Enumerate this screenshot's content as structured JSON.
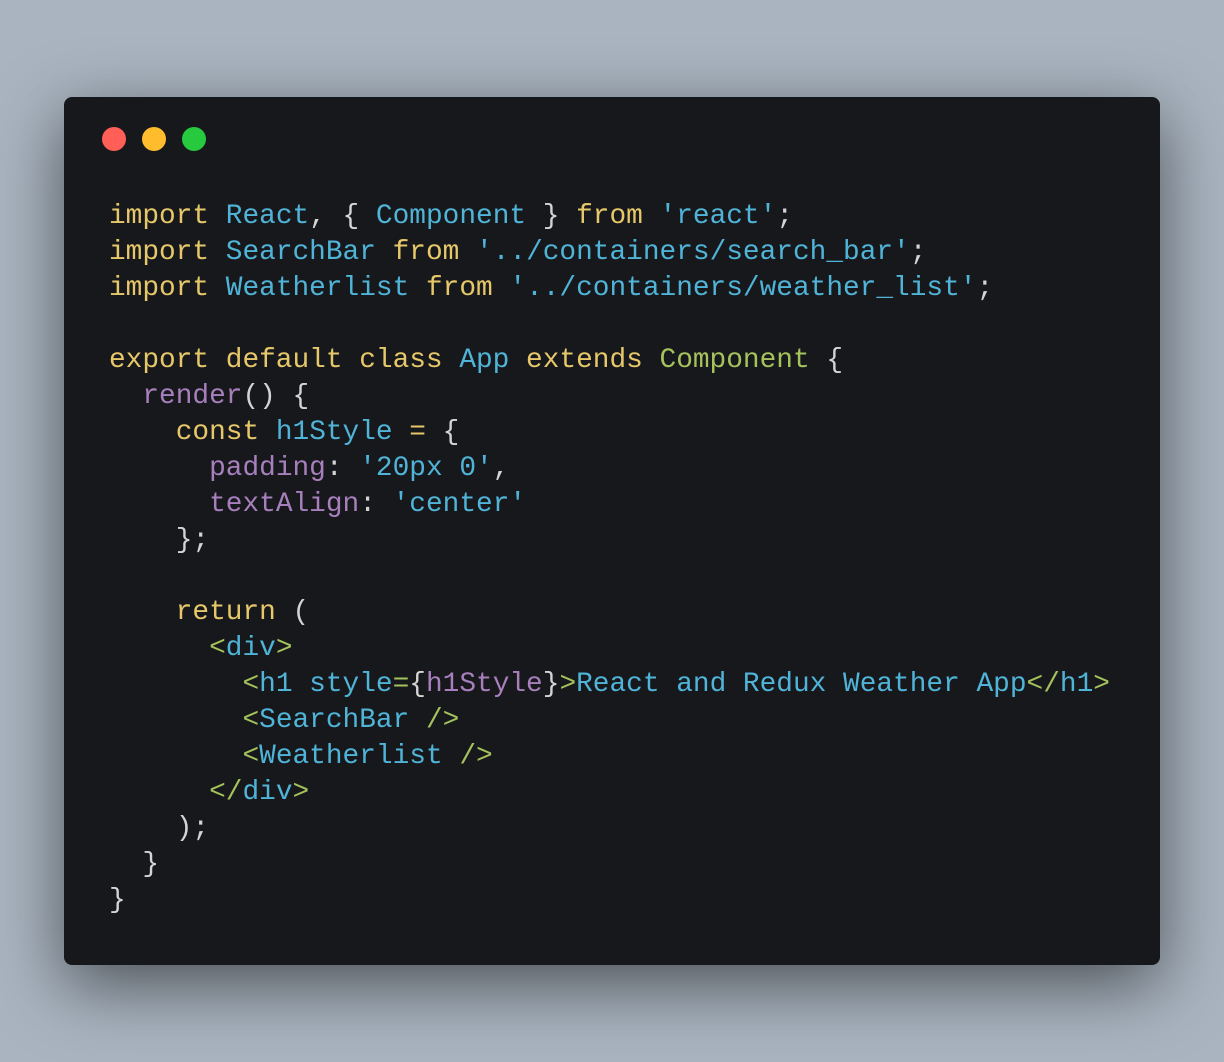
{
  "window": {
    "controls": [
      "close",
      "minimize",
      "maximize"
    ],
    "colors": {
      "close": "#ff5f56",
      "minimize": "#ffbd2e",
      "maximize": "#27c93f",
      "background": "#17181b",
      "page": "#a9b4c0"
    }
  },
  "code": {
    "lines": [
      [
        [
          "kw",
          "import"
        ],
        [
          "pun",
          " "
        ],
        [
          "id",
          "React"
        ],
        [
          "pun",
          ", { "
        ],
        [
          "id",
          "Component"
        ],
        [
          "pun",
          " } "
        ],
        [
          "kw",
          "from"
        ],
        [
          "pun",
          " "
        ],
        [
          "str",
          "'react'"
        ],
        [
          "pun",
          ";"
        ]
      ],
      [
        [
          "kw",
          "import"
        ],
        [
          "pun",
          " "
        ],
        [
          "id",
          "SearchBar"
        ],
        [
          "pun",
          " "
        ],
        [
          "kw",
          "from"
        ],
        [
          "pun",
          " "
        ],
        [
          "str",
          "'../containers/search_bar'"
        ],
        [
          "pun",
          ";"
        ]
      ],
      [
        [
          "kw",
          "import"
        ],
        [
          "pun",
          " "
        ],
        [
          "id",
          "Weatherlist"
        ],
        [
          "pun",
          " "
        ],
        [
          "kw",
          "from"
        ],
        [
          "pun",
          " "
        ],
        [
          "str",
          "'../containers/weather_list'"
        ],
        [
          "pun",
          ";"
        ]
      ],
      [],
      [
        [
          "kw",
          "export default class"
        ],
        [
          "pun",
          " "
        ],
        [
          "id",
          "App"
        ],
        [
          "pun",
          " "
        ],
        [
          "kw",
          "extends"
        ],
        [
          "pun",
          " "
        ],
        [
          "cls",
          "Component"
        ],
        [
          "pun",
          " {"
        ]
      ],
      [
        [
          "pun",
          "  "
        ],
        [
          "fn",
          "render"
        ],
        [
          "pun",
          "() {"
        ]
      ],
      [
        [
          "pun",
          "    "
        ],
        [
          "kw",
          "const"
        ],
        [
          "pun",
          " "
        ],
        [
          "id",
          "h1Style"
        ],
        [
          "pun",
          " "
        ],
        [
          "kw",
          "="
        ],
        [
          "pun",
          " {"
        ]
      ],
      [
        [
          "pun",
          "      "
        ],
        [
          "prop",
          "padding"
        ],
        [
          "pun",
          ": "
        ],
        [
          "str",
          "'20px 0'"
        ],
        [
          "pun",
          ","
        ]
      ],
      [
        [
          "pun",
          "      "
        ],
        [
          "prop",
          "textAlign"
        ],
        [
          "pun",
          ": "
        ],
        [
          "str",
          "'center'"
        ]
      ],
      [
        [
          "pun",
          "    };"
        ]
      ],
      [],
      [
        [
          "pun",
          "    "
        ],
        [
          "kw",
          "return"
        ],
        [
          "pun",
          " ("
        ]
      ],
      [
        [
          "pun",
          "      "
        ],
        [
          "tag",
          "<"
        ],
        [
          "tn",
          "div"
        ],
        [
          "tag",
          ">"
        ]
      ],
      [
        [
          "pun",
          "        "
        ],
        [
          "tag",
          "<"
        ],
        [
          "tn",
          "h1 style"
        ],
        [
          "tag",
          "="
        ],
        [
          "pun",
          "{"
        ],
        [
          "fn",
          "h1Style"
        ],
        [
          "pun",
          "}"
        ],
        [
          "tag",
          ">"
        ],
        [
          "tn",
          "React and Redux Weather App"
        ],
        [
          "tag",
          "</"
        ],
        [
          "tn",
          "h1"
        ],
        [
          "tag",
          ">"
        ]
      ],
      [
        [
          "pun",
          "        "
        ],
        [
          "tag",
          "<"
        ],
        [
          "tn",
          "SearchBar"
        ],
        [
          "pun",
          " "
        ],
        [
          "tag",
          "/>"
        ]
      ],
      [
        [
          "pun",
          "        "
        ],
        [
          "tag",
          "<"
        ],
        [
          "tn",
          "Weatherlist"
        ],
        [
          "pun",
          " "
        ],
        [
          "tag",
          "/>"
        ]
      ],
      [
        [
          "pun",
          "      "
        ],
        [
          "tag",
          "</"
        ],
        [
          "tn",
          "div"
        ],
        [
          "tag",
          ">"
        ]
      ],
      [
        [
          "pun",
          "    );"
        ]
      ],
      [
        [
          "pun",
          "  }"
        ]
      ],
      [
        [
          "pun",
          "}"
        ]
      ]
    ]
  }
}
